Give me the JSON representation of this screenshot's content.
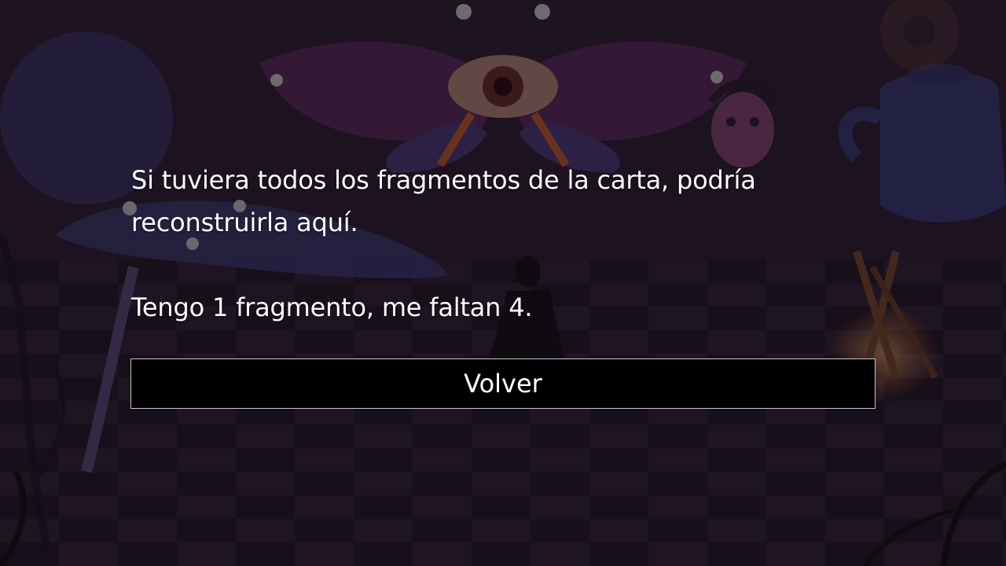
{
  "dialog": {
    "line1": "Si tuviera todos los fragmentos de la carta, podría",
    "line2": "reconstruirla aquí.",
    "line3": "Tengo 1 fragmento, me faltan 4."
  },
  "actions": {
    "back_label": "Volver"
  },
  "colors": {
    "text": "#ffffff",
    "button_bg": "#000000",
    "button_border": "#c8c8c8",
    "scene_dark": "#1e1420",
    "checker_light": "#3a2a3c",
    "checker_dark": "#241826"
  }
}
